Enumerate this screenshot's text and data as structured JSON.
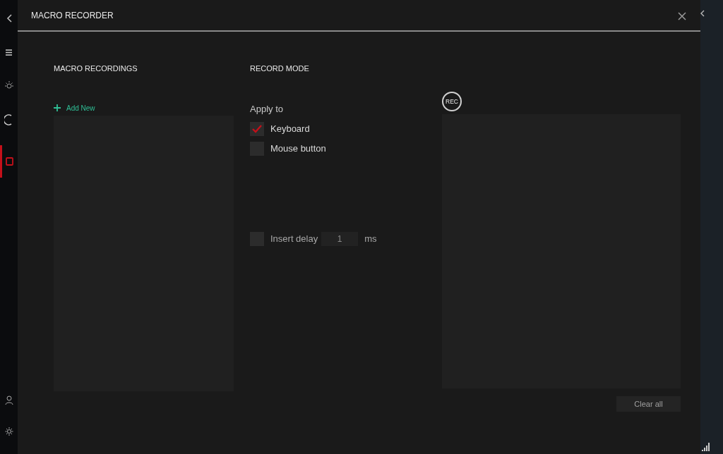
{
  "sidebar": {
    "items": [
      {
        "kind": "lighting",
        "selected": false
      },
      {
        "kind": "performance",
        "selected": false
      },
      {
        "kind": "macro",
        "selected": true
      }
    ],
    "footer_items": [
      {
        "kind": "profile"
      },
      {
        "kind": "settings"
      }
    ]
  },
  "window": {
    "title": "MACRO RECORDER"
  },
  "recordings": {
    "heading": "MACRO RECORDINGS",
    "add_label": "Add New"
  },
  "record_mode": {
    "heading": "RECORD MODE",
    "apply_label": "Apply to",
    "options": [
      {
        "label": "Keyboard",
        "checked": true
      },
      {
        "label": "Mouse button",
        "checked": false
      }
    ],
    "delay": {
      "label": "Insert delay",
      "checked": false,
      "value": "1",
      "unit": "ms"
    }
  },
  "recorder": {
    "rec_label": "REC",
    "clear_label": "Clear all"
  }
}
